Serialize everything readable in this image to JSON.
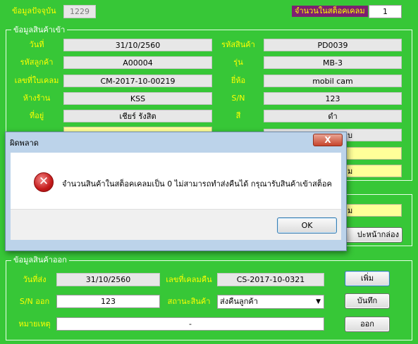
{
  "header": {
    "current_data_label": "ข้อมูลปัจจุบัน",
    "current_data_value": "1229",
    "claim_stock_label": "จำนวนในสต็อคเคลม",
    "claim_stock_value": "1"
  },
  "incoming": {
    "title": "ข้อมูลสินค้าเข้า",
    "date_label": "วันที่",
    "date_value": "31/10/2560",
    "product_code_label": "รหัสสินค้า",
    "product_code_value": "PD0039",
    "customer_code_label": "รหัสลูกค้า",
    "customer_code_value": "A00004",
    "model_label": "รุ่น",
    "model_value": "MB-3",
    "claim_no_label": "เลขที่ใบเคลม",
    "claim_no_value": "CM-2017-10-00219",
    "brand_label": "ยี่ห้อ",
    "brand_value": "mobil cam",
    "store_label": "ห้างร้าน",
    "store_value": "KSS",
    "sn_label": "S/N",
    "sn_value": "123",
    "address_label": "ที่อยู่",
    "address_value": "เชียร์ รังสิต",
    "color_label": "สี",
    "color_value": "ดำ",
    "partial_right_1": "บ",
    "partial_right_2": "ม",
    "partial_right_3": "ม"
  },
  "box_button_partial": "ปะหน้ากล่อง",
  "outgoing": {
    "title": "ข้อมูลสินค้าออก",
    "send_date_label": "วันที่ส่ง",
    "send_date_value": "31/10/2560",
    "return_claim_no_label": "เลขที่เคลมคืน",
    "return_claim_no_value": "CS-2017-10-0321",
    "sn_out_label": "S/N ออก",
    "sn_out_value": "123",
    "status_label": "สถานะสินค้า",
    "status_value": "ส่งคืนลูกค้า",
    "remark_label": "หมายเหตุ",
    "remark_value": "-",
    "add_button": "เพิ่ม",
    "save_button": "บันทึก",
    "exit_button": "ออก"
  },
  "dialog": {
    "title": "ผิดพลาด",
    "close_label": "X",
    "message": "จำนวนสินค้าในสต็อคเคลมเป็น 0 ไม่สามารถทำส่งคืนได้ กรุณารับสินค้าเข้าสต็อค",
    "ok_button": "OK"
  },
  "colors": {
    "background": "#37c737",
    "label_text": "#ffff00",
    "claim_tag": "#7e1f72",
    "error_icon": "#c41a1a"
  }
}
